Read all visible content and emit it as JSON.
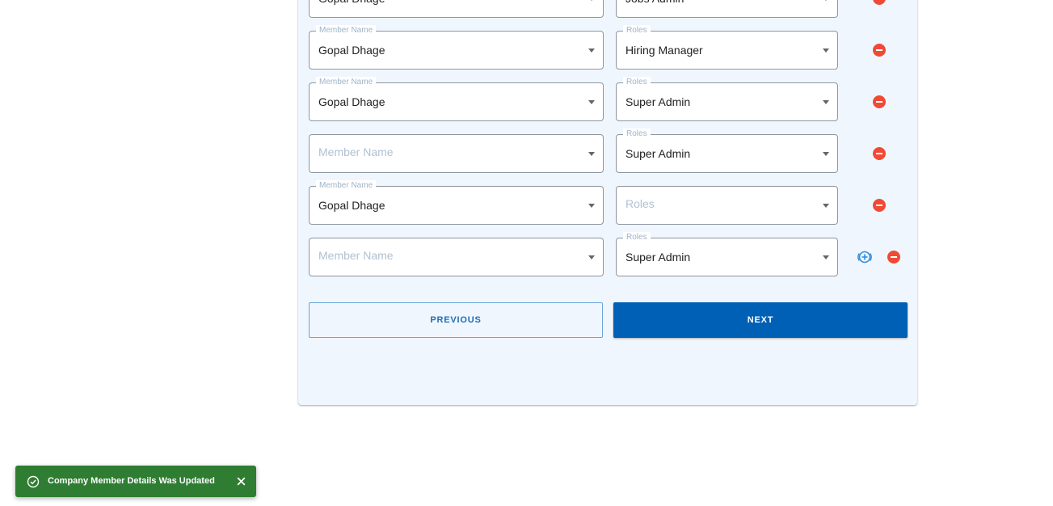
{
  "form": {
    "member_label": "Member Name",
    "roles_label": "Roles",
    "rows": [
      {
        "member": "Gopal Dhage",
        "role": "Jobs Admin"
      },
      {
        "member": "Gopal Dhage",
        "role": "Hiring Manager"
      },
      {
        "member": "Gopal Dhage",
        "role": "Super Admin"
      },
      {
        "member": "",
        "role": "Super Admin"
      },
      {
        "member": "Gopal Dhage",
        "role": ""
      },
      {
        "member": "",
        "role": "Super Admin"
      }
    ]
  },
  "actions": {
    "previous_label": "PREVIOUS",
    "next_label": "NEXT"
  },
  "toast": {
    "message": "Company Member Details Was Updated"
  },
  "colors": {
    "remove": "#f04a37",
    "add": "#2f8ee0",
    "primary": "#0060b6",
    "toast": "#2e7d32"
  },
  "icons": {
    "remove": "minus-circle-icon",
    "add": "plus-circle-icon",
    "dropdown": "caret-down-icon",
    "toast_status": "check-circle-icon",
    "toast_close": "close-icon"
  }
}
